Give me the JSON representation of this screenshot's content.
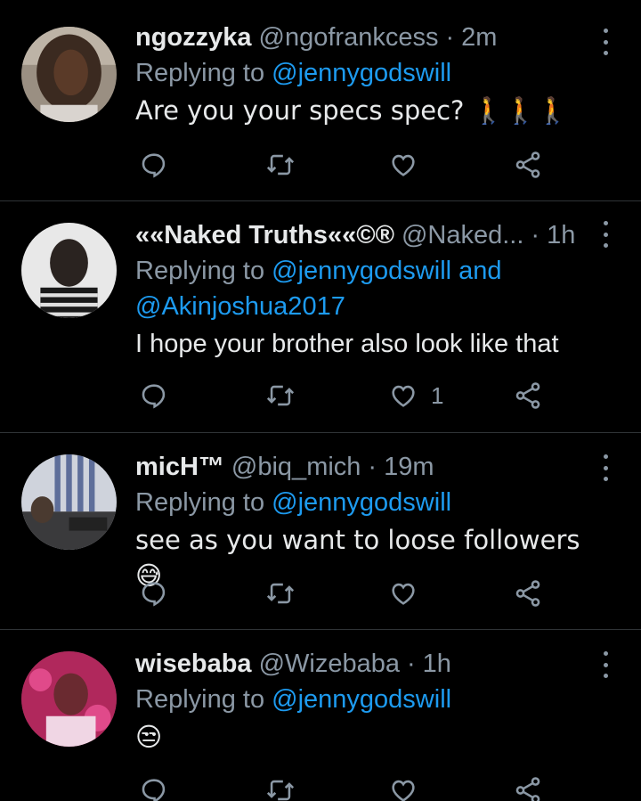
{
  "tweets": [
    {
      "name": "ngozzyka",
      "handle": "@ngofrankcess",
      "time": "· 2m",
      "replying_prefix": "Replying to",
      "mentions_line1": "@jennygodswill",
      "mentions_line2": "",
      "text": "Are you your specs spec? 🚶🚶🚶",
      "like_count": ""
    },
    {
      "name": "««Naked Truths««©®",
      "handle": "@Naked...",
      "time": "· 1h",
      "replying_prefix": "Replying to",
      "mentions_line1": "@jennygodswill and",
      "mentions_line2": "@Akinjoshua2017",
      "text": "I hope your brother also look like that",
      "like_count": "1"
    },
    {
      "name": "micH™",
      "handle": "@biq_mich",
      "time": "· 19m",
      "replying_prefix": "Replying to",
      "mentions_line1": "@jennygodswill",
      "mentions_line2": "",
      "text": "see as you want to loose followers😅",
      "like_count": ""
    },
    {
      "name": "wisebaba",
      "handle": "@Wizebaba",
      "time": "· 1h",
      "replying_prefix": "Replying to",
      "mentions_line1": "@jennygodswill",
      "mentions_line2": "",
      "text": "😒",
      "like_count": ""
    }
  ],
  "icons": {
    "reply": "reply-icon",
    "retweet": "retweet-icon",
    "like": "heart-icon",
    "share": "share-icon",
    "more": "more-vertical-icon"
  },
  "colors": {
    "background": "#000000",
    "text": "#e7e9ea",
    "muted": "#8b98a5",
    "accent": "#1d9bf0",
    "divider": "#2f3336"
  }
}
